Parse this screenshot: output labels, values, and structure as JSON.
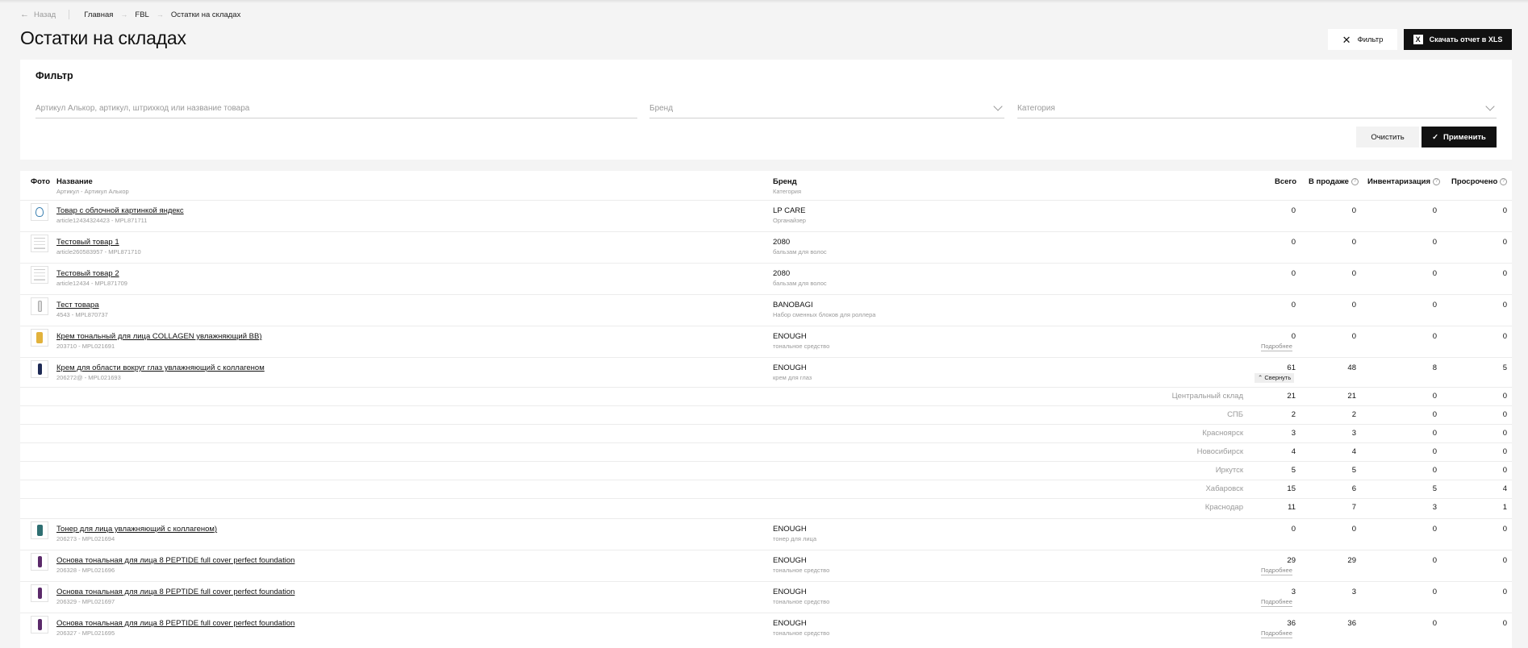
{
  "breadcrumb": {
    "back": "Назад",
    "items": [
      "Главная",
      "FBL",
      "Остатки на складах"
    ]
  },
  "page_title": "Остатки на складах",
  "actions": {
    "filter": "Фильтр",
    "download": "Скачать отчет в XLS"
  },
  "filter": {
    "title": "Фильтр",
    "search_placeholder": "Артикул Алькор, артикул, штрихкод или название товара",
    "brand_placeholder": "Бренд",
    "category_placeholder": "Категория",
    "clear": "Очистить",
    "apply": "Применить"
  },
  "table": {
    "headers": {
      "photo": "Фото",
      "name": "Название",
      "name_sub": "Артикул - Артикул Алькор",
      "brand": "Бренд",
      "brand_sub": "Категория",
      "total": "Всего",
      "on_sale": "В продаже",
      "inventory": "Инвентаризация",
      "expired": "Просрочено"
    },
    "rows": [
      {
        "name": "Товар с облочной картинкой яндекс",
        "article": "article12434324423 - MPL871711",
        "brand": "LP CARE",
        "category": "Органайзер",
        "total": "0",
        "sale": "0",
        "inv": "0",
        "exp": "0"
      },
      {
        "name": "Тестовый товар 1",
        "article": "article260583957 - MPL871710",
        "brand": "2080",
        "category": "бальзам для волос",
        "total": "0",
        "sale": "0",
        "inv": "0",
        "exp": "0"
      },
      {
        "name": "Тестовый товар 2",
        "article": "article12434 - MPL871709",
        "brand": "2080",
        "category": "бальзам для волос",
        "total": "0",
        "sale": "0",
        "inv": "0",
        "exp": "0"
      },
      {
        "name": "Тест товара",
        "article": "4543 - MPL870737",
        "brand": "BANOBAGI",
        "category": "Набор сменных блоков для роллера",
        "total": "0",
        "sale": "0",
        "inv": "0",
        "exp": "0"
      },
      {
        "name": "Крем тональный для лица COLLAGEN увлажняющий BB)",
        "article": "203710 - MPL021691",
        "brand": "ENOUGH",
        "category": "тональное средство",
        "total": "0",
        "sale": "0",
        "inv": "0",
        "exp": "0",
        "link": "Подробнее"
      },
      {
        "name": "Крем для области вокруг глаз увлажняющий с коллагеном",
        "article": "206272@ - MPL021693",
        "brand": "ENOUGH",
        "category": "крем для глаз",
        "total": "61",
        "sale": "48",
        "inv": "8",
        "exp": "5",
        "link": "Свернуть"
      },
      {
        "name": " Тонер для лица увлажняющий с коллагеном)",
        "article": "206273 - MPL021694",
        "brand": "ENOUGH",
        "category": "тонер для лица",
        "total": "0",
        "sale": "0",
        "inv": "0",
        "exp": "0"
      },
      {
        "name": "Основа тональная для лица 8 PEPTIDE full cover perfect foundation",
        "article": "206328 - MPL021696",
        "brand": "ENOUGH",
        "category": "тональное средство",
        "total": "29",
        "sale": "29",
        "inv": "0",
        "exp": "0",
        "link": "Подробнее"
      },
      {
        "name": "Основа тональная для лица 8 PEPTIDE full cover perfect foundation",
        "article": "206329 - MPL021697",
        "brand": "ENOUGH",
        "category": "тональное средство",
        "total": "3",
        "sale": "3",
        "inv": "0",
        "exp": "0",
        "link": "Подробнее"
      },
      {
        "name": "Основа тональная для лица 8 PEPTIDE full cover perfect foundation",
        "article": "206327 - MPL021695",
        "brand": "ENOUGH",
        "category": "тональное средство",
        "total": "36",
        "sale": "36",
        "inv": "0",
        "exp": "0",
        "link": "Подробнее"
      }
    ],
    "warehouses": [
      {
        "name": "Центральный склад",
        "total": "21",
        "sale": "21",
        "inv": "0",
        "exp": "0"
      },
      {
        "name": "СПБ",
        "total": "2",
        "sale": "2",
        "inv": "0",
        "exp": "0"
      },
      {
        "name": "Красноярск",
        "total": "3",
        "sale": "3",
        "inv": "0",
        "exp": "0"
      },
      {
        "name": "Новосибирск",
        "total": "4",
        "sale": "4",
        "inv": "0",
        "exp": "0"
      },
      {
        "name": "Иркутск",
        "total": "5",
        "sale": "5",
        "inv": "0",
        "exp": "0"
      },
      {
        "name": "Хабаровск",
        "total": "15",
        "sale": "6",
        "inv": "5",
        "exp": "4"
      },
      {
        "name": "Краснодар",
        "total": "11",
        "sale": "7",
        "inv": "3",
        "exp": "1"
      }
    ]
  },
  "thumbs": [
    "mirror",
    "doc",
    "doc",
    "bottle-white",
    "tube-yellow",
    "tube-navy",
    "bottle-teal",
    "bottle-purple",
    "bottle-purple",
    "bottle-purple"
  ]
}
